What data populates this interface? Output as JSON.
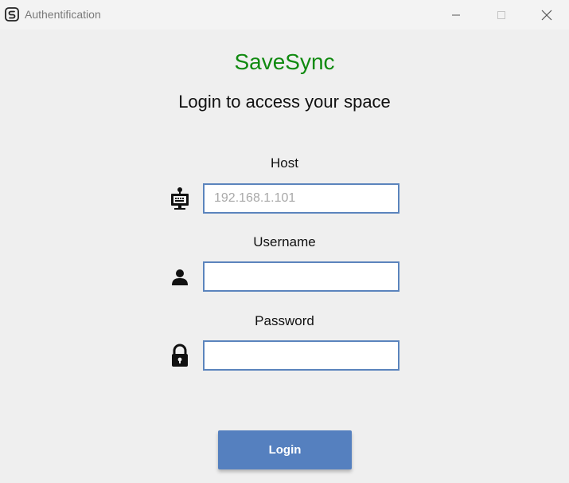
{
  "window": {
    "title": "Authentification",
    "app_icon": "savesync-logo-icon",
    "controls": [
      "minimize-icon",
      "maximize-icon",
      "close-icon"
    ]
  },
  "app": {
    "brand": "SaveSync",
    "subtitle": "Login to access your space",
    "brand_color": "#108a10",
    "accent_color": "#5580bf"
  },
  "form": {
    "host": {
      "label": "Host",
      "placeholder": "192.168.1.101",
      "value": "",
      "icon": "host-computer-icon"
    },
    "username": {
      "label": "Username",
      "placeholder": "",
      "value": "",
      "icon": "user-icon"
    },
    "password": {
      "label": "Password",
      "placeholder": "",
      "value": "",
      "icon": "lock-icon"
    },
    "login_label": "Login"
  }
}
